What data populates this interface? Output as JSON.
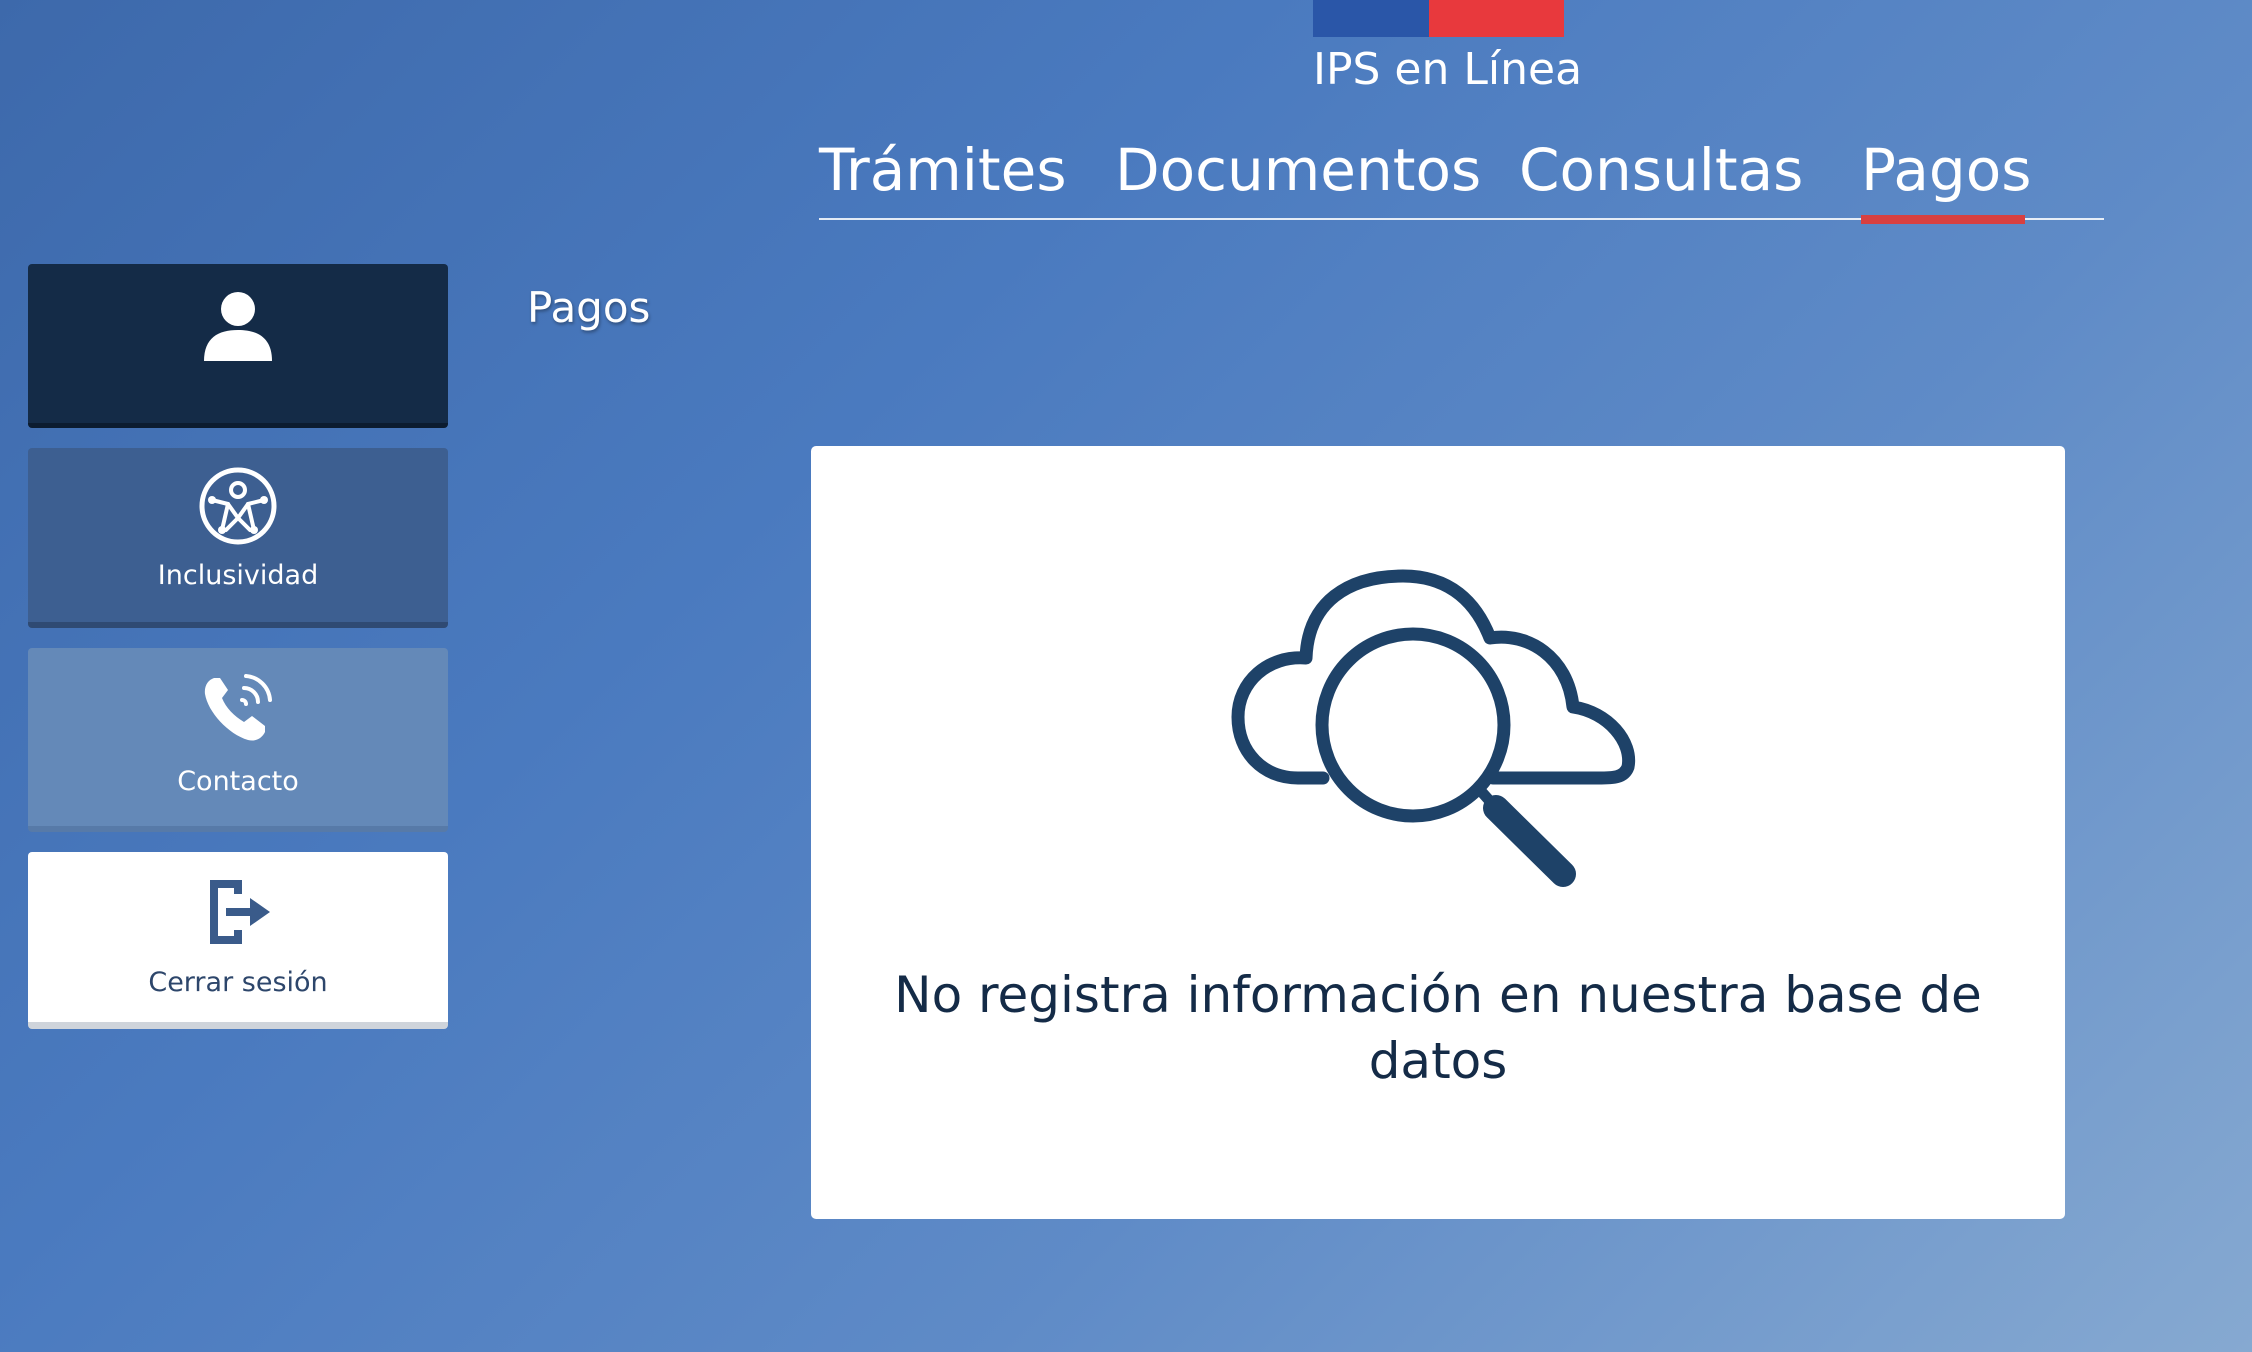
{
  "header": {
    "site_title": "IPS en Línea",
    "flag_colors": [
      "#2a56a8",
      "#e8393d"
    ]
  },
  "nav": {
    "tabs": [
      {
        "label": "Trámites",
        "active": false
      },
      {
        "label": "Documentos",
        "active": false
      },
      {
        "label": "Consultas",
        "active": false
      },
      {
        "label": "Pagos",
        "active": true
      }
    ],
    "active_indicator_color": "#d84040"
  },
  "sidebar": {
    "items": [
      {
        "icon": "user-icon",
        "label": ""
      },
      {
        "icon": "accessibility-icon",
        "label": "Inclusividad"
      },
      {
        "icon": "phone-icon",
        "label": "Contacto"
      },
      {
        "icon": "logout-icon",
        "label": "Cerrar sesión"
      }
    ]
  },
  "main": {
    "section_title": "Pagos",
    "empty_state": {
      "icon": "cloud-search-icon",
      "message": "No registra información en nuestra base de datos"
    }
  },
  "colors": {
    "primary_dark": "#142b47",
    "icon_stroke": "#1e4268"
  }
}
